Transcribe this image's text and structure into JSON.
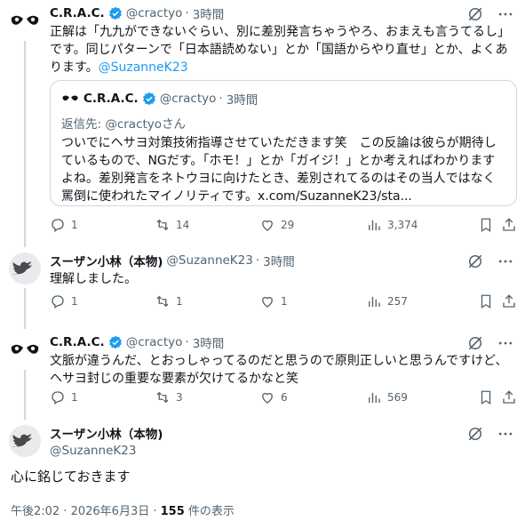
{
  "tweets": [
    {
      "name": "C.R.A.C.",
      "handle": "@cractyo",
      "time": "3時間",
      "text_lines": [
        "正解は「九九ができないぐらい、別に差別発言ちゃうやろ、おまえも言うてるし」",
        "です。同じパターンで「日本語読めない」とか「国語からやり直せ」とか、よくあ",
        "ります。"
      ],
      "mention": "@SuzanneK23",
      "quote": {
        "name": "C.R.A.C.",
        "handle": "@cractyo",
        "time": "3時間",
        "reply_to": "返信先: @cractyoさん",
        "text_lines": [
          "ついでにヘサヨ対策技術指導させていただきます笑　この反論は彼らが期待し",
          "ているもので、NGだす。「ホモ！」とか「ガイジ！」とか考えればわかります",
          "よね。差別発言をネトウヨに向けたとき、差別されてるのはその当人ではなく",
          "罵倒に使われたマイノリティです。x.com/SuzanneK23/sta..."
        ]
      },
      "counts": {
        "replies": "1",
        "retweets": "14",
        "likes": "29",
        "views": "3,374"
      }
    },
    {
      "name": "スーザン小林（本物)",
      "handle": "@SuzanneK23",
      "time": "3時間",
      "text": "理解しました。",
      "counts": {
        "replies": "1",
        "retweets": "1",
        "likes": "1",
        "views": "257"
      }
    },
    {
      "name": "C.R.A.C.",
      "handle": "@cractyo",
      "time": "3時間",
      "text_lines": [
        "文脈が違うんだ、とおっしゃってるのだと思うので原則正しいと思うんですけど、",
        "ヘサヨ封じの重要な要素が欠けてるかなと笑"
      ],
      "counts": {
        "replies": "1",
        "retweets": "3",
        "likes": "6",
        "views": "569"
      }
    }
  ],
  "main": {
    "name": "スーザン小林（本物)",
    "handle": "@SuzanneK23",
    "text": "心に銘じておきます",
    "timestamp": "午後2:02 · 2026年6月3日 · ",
    "views_count": "155",
    "views_label": " 件の表示"
  },
  "colors": {
    "accent": "#1d9bf0",
    "muted": "#536471",
    "border": "#cfd9de"
  }
}
